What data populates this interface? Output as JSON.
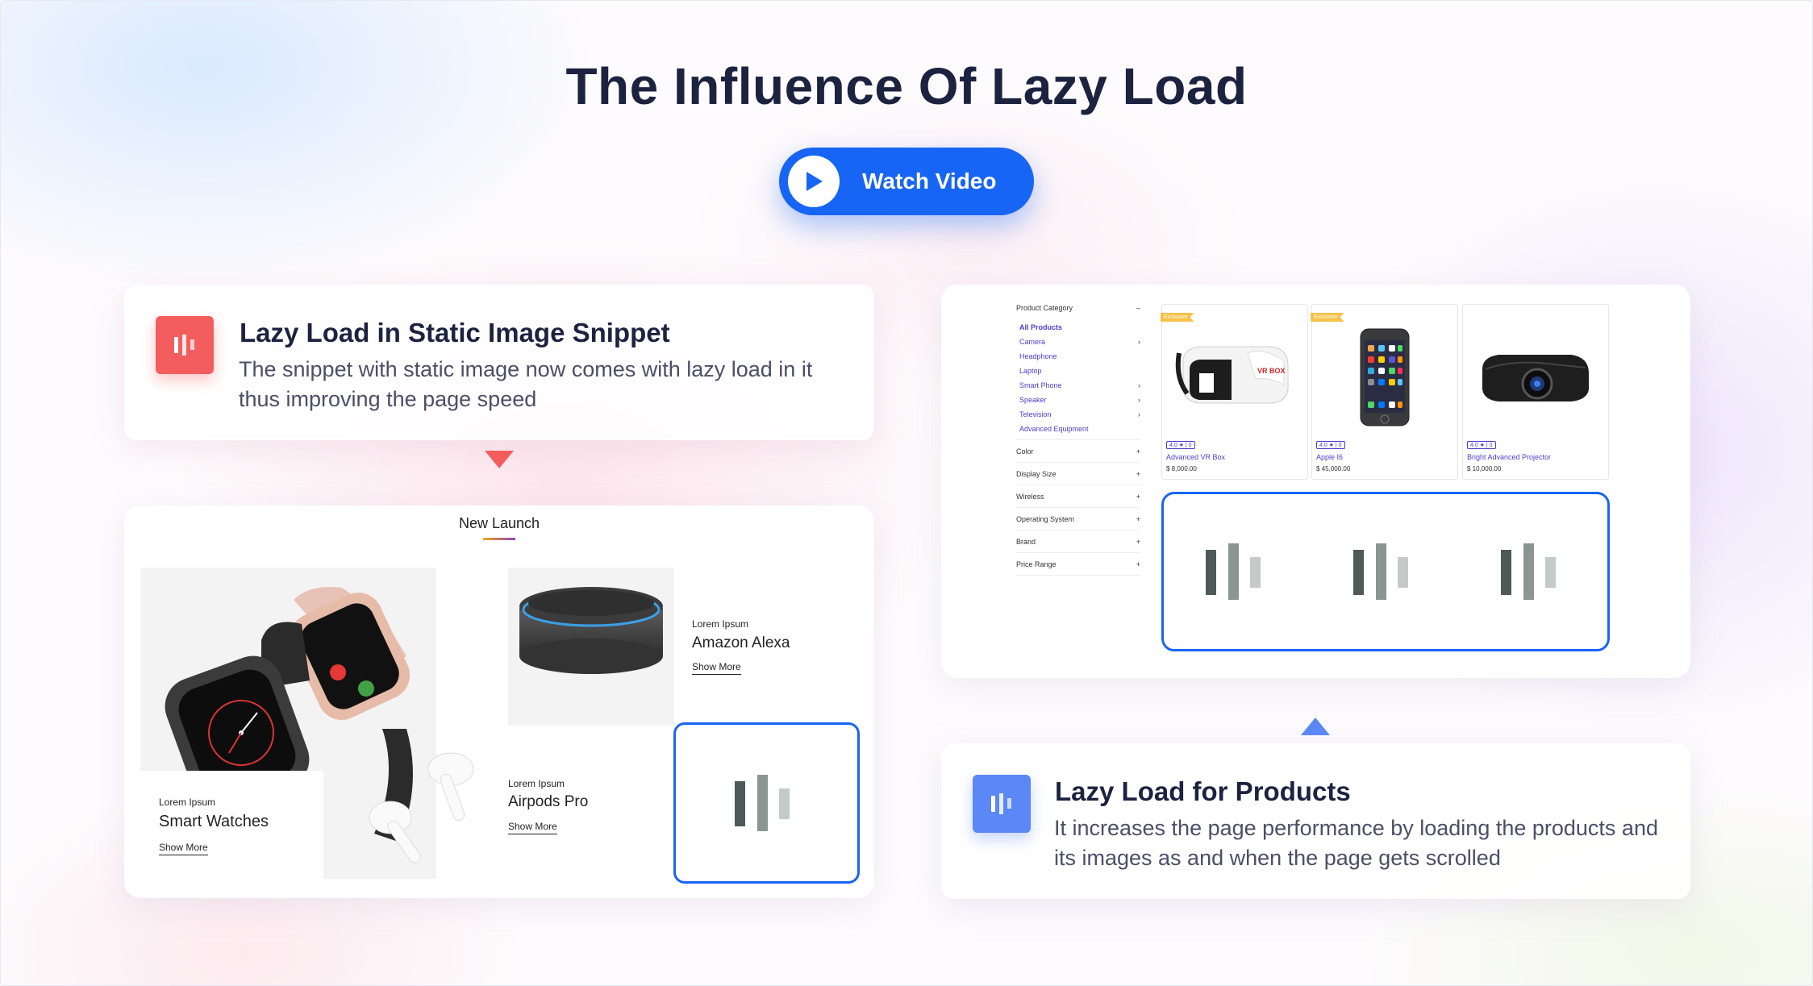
{
  "page": {
    "title": "The Influence Of Lazy Load",
    "watch_video_label": "Watch Video"
  },
  "static_snippet": {
    "title": "Lazy Load in Static Image Snippet",
    "description": "The snippet with static image now comes with lazy load in it thus improving the page speed",
    "accent": "#f45d5d",
    "section_title": "New Launch",
    "items": [
      {
        "kicker": "Lorem Ipsum",
        "name": "Smart Watches",
        "link": "Show More"
      },
      {
        "kicker": "Lorem Ipsum",
        "name": "Amazon Alexa",
        "link": "Show More"
      },
      {
        "kicker": "Lorem Ipsum",
        "name": "Airpods Pro",
        "link": "Show More"
      }
    ]
  },
  "products_lazy": {
    "title": "Lazy Load for Products",
    "description": "It increases the page performance by loading the products and its images as and when the page gets scrolled",
    "accent": "#5b87f7",
    "sidebar": {
      "heading": "Product Category",
      "categories": [
        "All Products",
        "Camera",
        "Headphone",
        "Laptop",
        "Smart Phone",
        "Speaker",
        "Television",
        "Advanced Equipment"
      ],
      "filters": [
        "Color",
        "Display Size",
        "Wireless",
        "Operating System",
        "Brand",
        "Price Range"
      ]
    },
    "products": [
      {
        "badge": "Exclusive",
        "rating": "4.0 ★ | 0",
        "name": "Advanced VR Box",
        "price": "$ 8,000.00"
      },
      {
        "badge": "Exclusive",
        "rating": "4.0 ★ | 0",
        "name": "Apple I6",
        "price": "$ 45,000.00"
      },
      {
        "badge": "",
        "rating": "4.0 ★ | 0",
        "name": "Bright Advanced Projector",
        "price": "$ 10,000.00"
      }
    ]
  },
  "colors": {
    "primary": "#1765f5",
    "heading": "#1c2340"
  }
}
